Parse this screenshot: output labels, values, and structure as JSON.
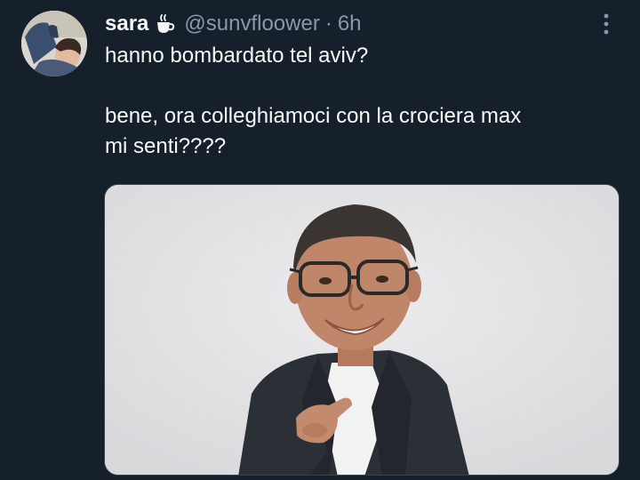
{
  "tweet": {
    "display_name": "sara",
    "handle": "@sunvfloower",
    "separator": "·",
    "timestamp": "6h",
    "line1": "hanno bombardato tel aviv?",
    "line2": "bene, ora colleghiamoci con la crociera max\nmi senti????",
    "name_icon": "hot-beverage-icon",
    "more_icon": "more-options-icon"
  },
  "colors": {
    "background": "#15202b",
    "primary_text": "#f7f9f9",
    "secondary_text": "#8b98a5"
  }
}
